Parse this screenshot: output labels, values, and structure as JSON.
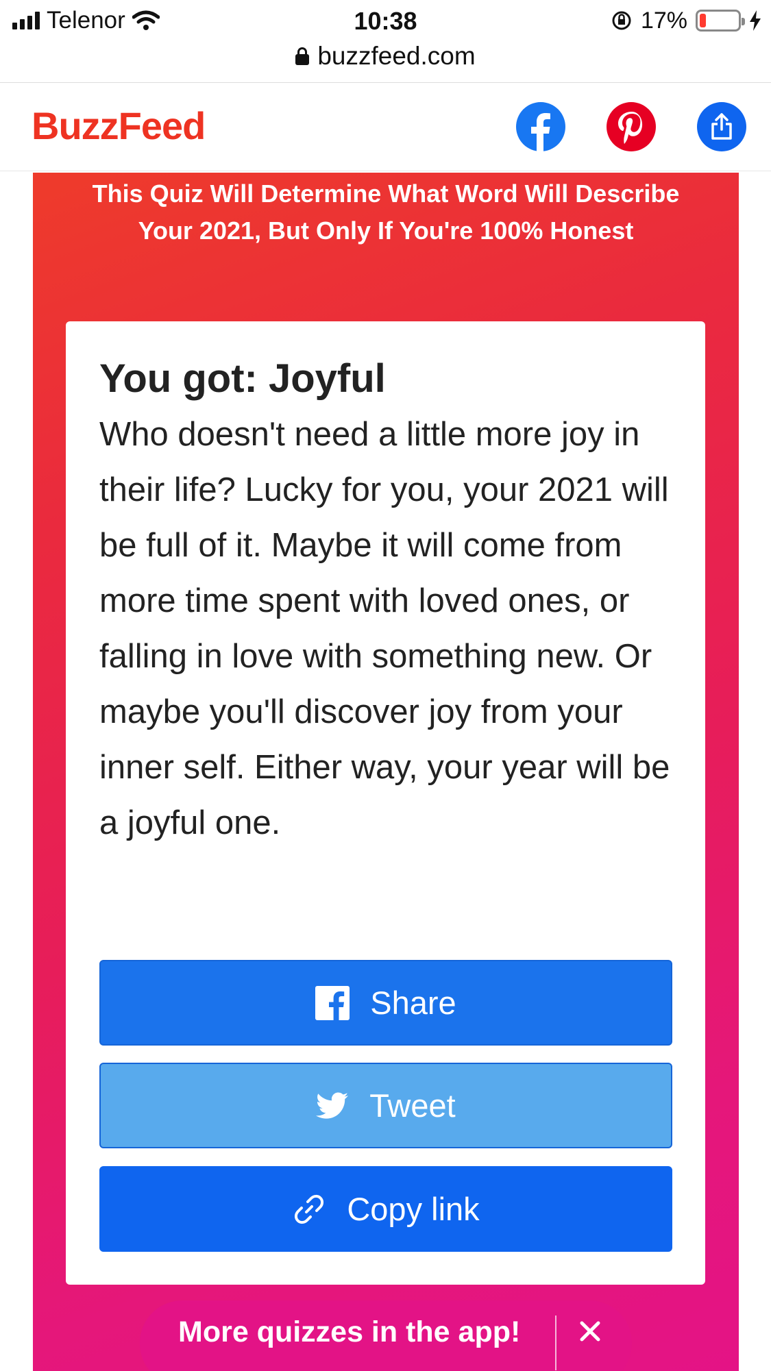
{
  "status_bar": {
    "carrier": "Telenor",
    "time": "10:38",
    "battery_percent": "17%",
    "battery_level": 0.17
  },
  "browser": {
    "url": "buzzfeed.com"
  },
  "header": {
    "logo": "BuzzFeed",
    "icons": [
      "facebook-icon",
      "pinterest-icon",
      "share-icon"
    ]
  },
  "quiz": {
    "title": "This Quiz Will Determine What Word Will Describe Your 2021, But Only If You're 100% Honest"
  },
  "result": {
    "heading": "You got: Joyful",
    "description": "Who doesn't need a little more joy in their life? Lucky for you, your 2021 will be full of it. Maybe it will come from more time spent with loved ones, or falling in love with something new. Or maybe you'll discover joy from your inner self. Either way, your year will be a joyful one."
  },
  "buttons": {
    "share_label": "Share",
    "tweet_label": "Tweet",
    "copy_label": "Copy link"
  },
  "app_banner": {
    "text": "More quizzes in the app!"
  },
  "colors": {
    "brand_red": "#ee3322",
    "facebook": "#1877f2",
    "pinterest": "#e60023",
    "share_blue": "#0f65ef",
    "tweet_blue": "#58aaed",
    "banner_pink": "#e31386"
  }
}
